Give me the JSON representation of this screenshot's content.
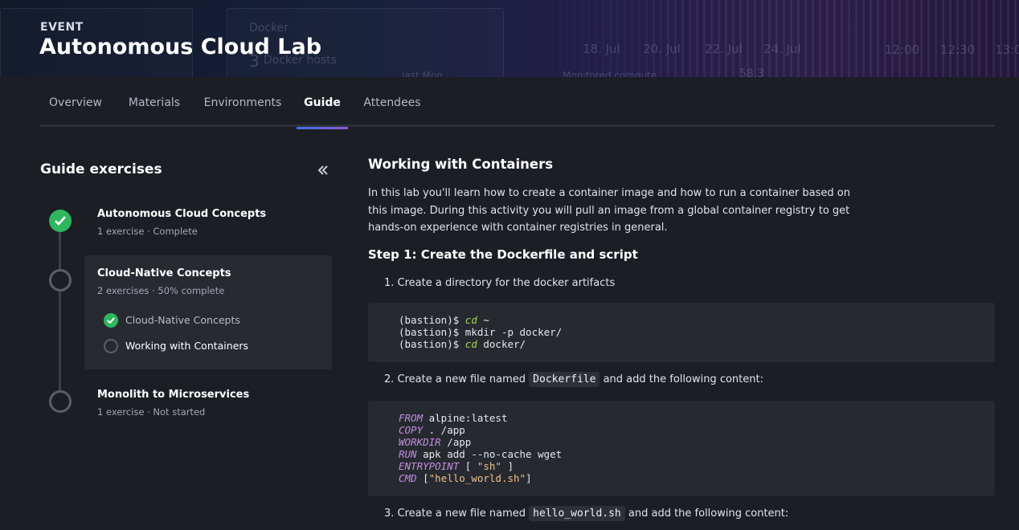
{
  "hero": {
    "label": "EVENT",
    "title": "Autonomous Cloud Lab",
    "bg_texts": [
      "Docker",
      "3",
      "Docker hosts",
      "18. Jul",
      "20. Jul",
      "22. Jul",
      "24. Jul",
      "12:00",
      "12:30",
      "13:0",
      "last Mon",
      "Monitored compute",
      "58.3"
    ]
  },
  "tabs": [
    {
      "label": "Overview",
      "active": false
    },
    {
      "label": "Materials",
      "active": false
    },
    {
      "label": "Environments",
      "active": false
    },
    {
      "label": "Guide",
      "active": true
    },
    {
      "label": "Attendees",
      "active": false
    }
  ],
  "sidebar": {
    "title": "Guide exercises",
    "collapse_icon": "double-chevron-left-icon",
    "steps": [
      {
        "title": "Autonomous Cloud Concepts",
        "subtitle": "1 exercise · Complete",
        "status": "complete"
      },
      {
        "title": "Cloud-Native Concepts",
        "subtitle": "2 exercises · 50% complete",
        "status": "in-progress",
        "items": [
          {
            "label": "Cloud-Native Concepts",
            "status": "complete"
          },
          {
            "label": "Working with Containers",
            "status": "current"
          }
        ]
      },
      {
        "title": "Monolith to Microservices",
        "subtitle": "1 exercise · Not started",
        "status": "not-started"
      }
    ]
  },
  "main": {
    "title": "Working with Containers",
    "intro": "In this lab you'll learn how to create a container image and how to run a container based on this image. During this activity you will pull an image from a global container registry to get hands-on experience with container registries in general.",
    "step1_title": "Step 1: Create the Dockerfile and script",
    "list": [
      {
        "num": "1.",
        "text": "Create a directory for the docker artifacts"
      },
      {
        "num": "2.",
        "pre": "Create a new file named ",
        "code": "Dockerfile",
        "post": " and add the following content:"
      },
      {
        "num": "3.",
        "pre": "Create a new file named ",
        "code": "hello_world.sh",
        "post": " and add the following content:"
      }
    ],
    "code1": [
      {
        "prompt": "(bastion)$ ",
        "cmd": "cd",
        "rest": " ~"
      },
      {
        "prompt": "(bastion)$ ",
        "cmd": "",
        "rest": "mkdir -p docker/"
      },
      {
        "prompt": "(bastion)$ ",
        "cmd": "cd",
        "rest": " docker/"
      }
    ],
    "code2": [
      {
        "kw": "FROM",
        "rest": " alpine:latest"
      },
      {
        "kw": "COPY",
        "rest": " . /app"
      },
      {
        "kw": "WORKDIR",
        "rest": " /app"
      },
      {
        "kw": "RUN",
        "rest": " apk add --no-cache wget"
      },
      {
        "kw": "ENTRYPOINT",
        "rest": " [ ",
        "str": "\"sh\"",
        "tail": " ]"
      },
      {
        "kw": "CMD",
        "rest": " [",
        "str": "\"hello_world.sh\"",
        "tail": "]"
      }
    ]
  },
  "colors": {
    "background": "#1b1e24",
    "success": "#2fb65f",
    "tab_underline_start": "#3b6fe0",
    "tab_underline_end": "#8b5bd6"
  }
}
